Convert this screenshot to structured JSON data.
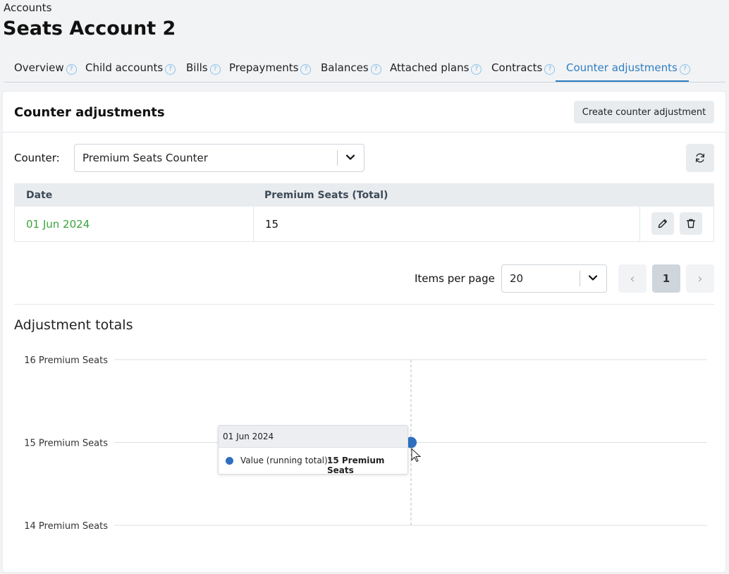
{
  "breadcrumb": "Accounts",
  "page_title": "Seats Account 2",
  "tabs": [
    {
      "label": "Overview"
    },
    {
      "label": "Child accounts"
    },
    {
      "label": "Bills"
    },
    {
      "label": "Prepayments"
    },
    {
      "label": "Balances"
    },
    {
      "label": "Attached plans"
    },
    {
      "label": "Contracts"
    },
    {
      "label": "Counter adjustments",
      "active": true
    }
  ],
  "help_glyph": "?",
  "card": {
    "title": "Counter adjustments",
    "create_button": "Create counter adjustment"
  },
  "counter": {
    "label": "Counter:",
    "selected": "Premium Seats Counter"
  },
  "icons": {
    "chevron": "chevron-down-icon",
    "refresh": "refresh-icon",
    "edit": "pencil-icon",
    "delete": "trash-icon"
  },
  "table": {
    "columns": [
      "Date",
      "Premium Seats (Total)"
    ],
    "rows": [
      {
        "date": "01 Jun 2024",
        "value": "15"
      }
    ]
  },
  "pagination": {
    "items_per_page_label": "Items per page",
    "items_per_page": "20",
    "prev": "‹",
    "current_page": "1",
    "next": "›"
  },
  "chart_data": {
    "type": "line",
    "title": "Adjustment totals",
    "yticks": [
      "14 Premium Seats",
      "15 Premium Seats",
      "16 Premium Seats"
    ],
    "ylim": [
      14,
      16
    ],
    "grid": true,
    "series": [
      {
        "name": "Value (running total)",
        "color": "#2f6fbf",
        "points": [
          {
            "x": "01 Jun 2024",
            "y": 15
          }
        ]
      }
    ],
    "tooltip": {
      "header": "01 Jun 2024",
      "label": "Value (running total):",
      "value": "15 Premium Seats"
    }
  },
  "colors": {
    "accent": "#2f7ec1",
    "date_link": "#3ca33e",
    "series": "#2f6fbf"
  }
}
